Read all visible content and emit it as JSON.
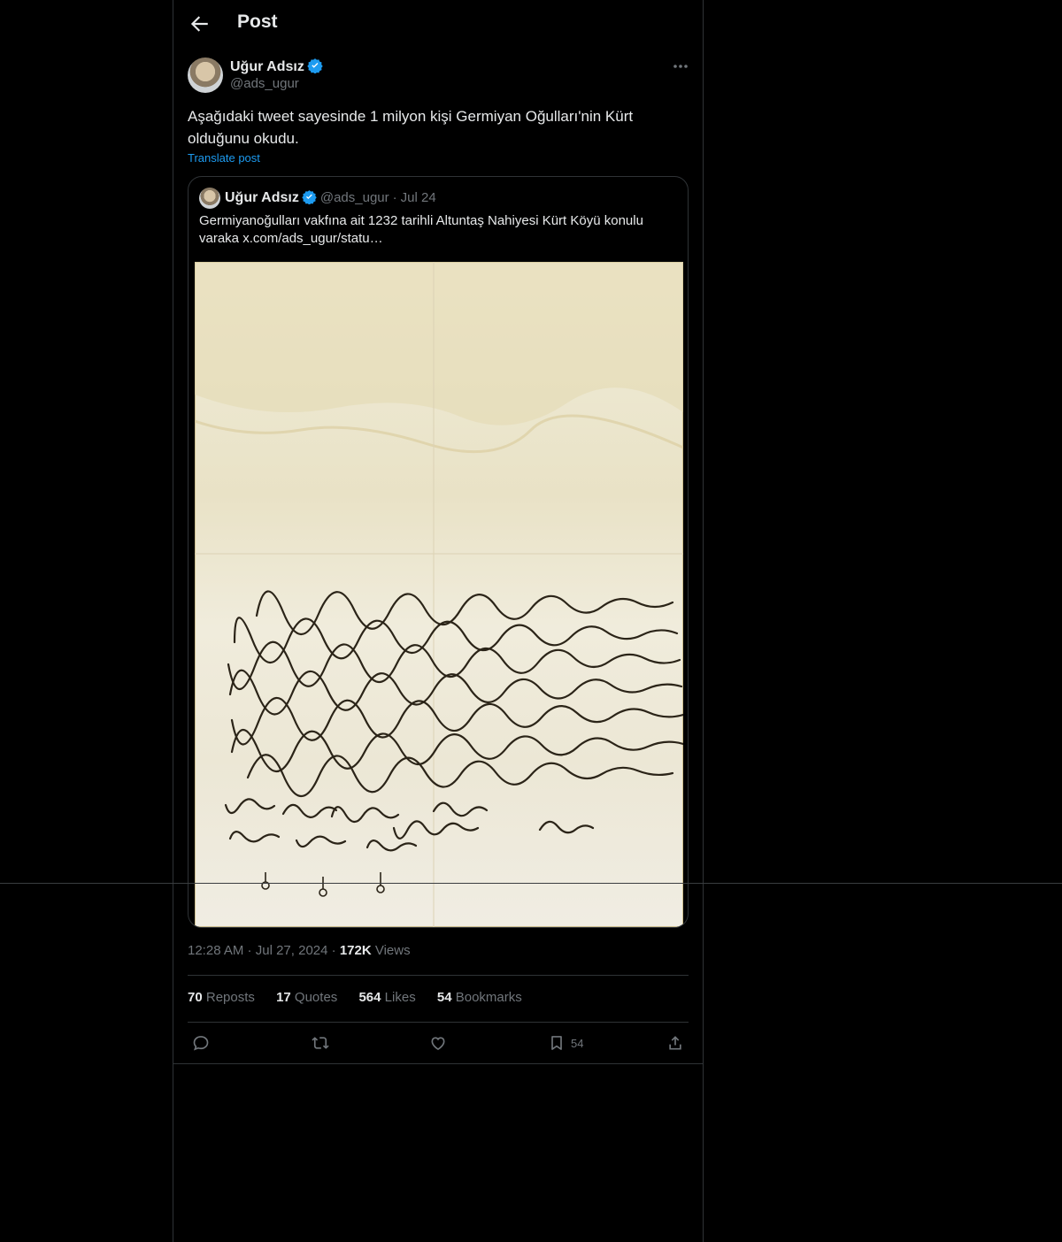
{
  "header": {
    "title": "Post"
  },
  "author": {
    "name": "Uğur Adsız",
    "handle": "@ads_ugur"
  },
  "tweet": {
    "text": "Aşağıdaki tweet sayesinde 1 milyon kişi Germiyan Oğulları'nin Kürt olduğunu okudu.",
    "translate_label": "Translate post"
  },
  "quote": {
    "name": "Uğur Adsız",
    "handle": "@ads_ugur",
    "date": "Jul 24",
    "text": "Germiyanoğulları vakfına ait 1232 tarihli Altuntaş Nahiyesi Kürt Köyü konulu varaka  x.com/ads_ugur/statu…"
  },
  "meta": {
    "time": "12:28 AM",
    "date": "Jul 27, 2024",
    "views_count": "172K",
    "views_label": "Views"
  },
  "stats": {
    "reposts_count": "70",
    "reposts_label": "Reposts",
    "quotes_count": "17",
    "quotes_label": "Quotes",
    "likes_count": "564",
    "likes_label": "Likes",
    "bookmarks_count": "54",
    "bookmarks_label": "Bookmarks"
  },
  "actions": {
    "bookmark_count": "54"
  },
  "icons": [
    "back-arrow-icon",
    "verified-badge-icon",
    "more-icon",
    "reply-icon",
    "repost-icon",
    "like-icon",
    "bookmark-icon",
    "share-icon"
  ],
  "colors": {
    "background": "#000000",
    "text": "#e7e9ea",
    "muted": "#71767b",
    "link": "#1d9bf0",
    "border": "#2f3336"
  }
}
